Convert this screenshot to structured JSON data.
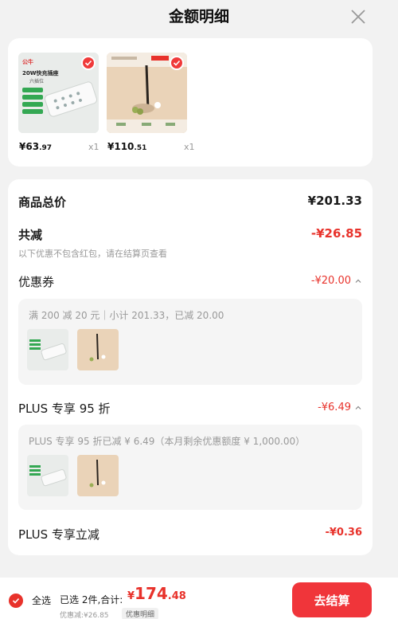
{
  "header": {
    "title": "金额明细",
    "close_icon": "close-icon"
  },
  "products": [
    {
      "price_int": "¥63",
      "price_dec": ".97",
      "qty": "x1",
      "image": "power-strip-image",
      "box_text": "20W快充插座",
      "box_sub": "六插位"
    },
    {
      "price_int": "¥110",
      "price_dec": ".51",
      "qty": "x1",
      "image": "pen-product-image"
    }
  ],
  "summary": {
    "total_label": "商品总价",
    "total_value": "¥201.33",
    "reduce_label": "共减",
    "reduce_value": "-¥26.85",
    "reduce_note": "以下优惠不包含红包，请在结算页查看"
  },
  "coupon": {
    "label": "优惠券",
    "value": "-¥20.00",
    "detail": "满 200 减 20 元｜小计 201.33，已减 20.00"
  },
  "plus_discount": {
    "label": "PLUS 专享 95 折",
    "value": "-¥6.49",
    "detail": "PLUS 专享 95 折已减 ¥ 6.49（本月剩余优惠额度 ¥ 1,000.00）"
  },
  "plus_instant": {
    "label": "PLUS 专享立减",
    "value": "-¥0.36"
  },
  "bottom": {
    "select_all": "全选",
    "selected_text": "已选 2件,合计:",
    "total_cur": "¥",
    "total_int": "174",
    "total_dec": ".48",
    "saved_note": "优惠减:¥26.85",
    "discount_tag": "优惠明细",
    "pay_button": "去结算"
  },
  "colors": {
    "accent": "#e8322b",
    "button": "#f0353a"
  }
}
